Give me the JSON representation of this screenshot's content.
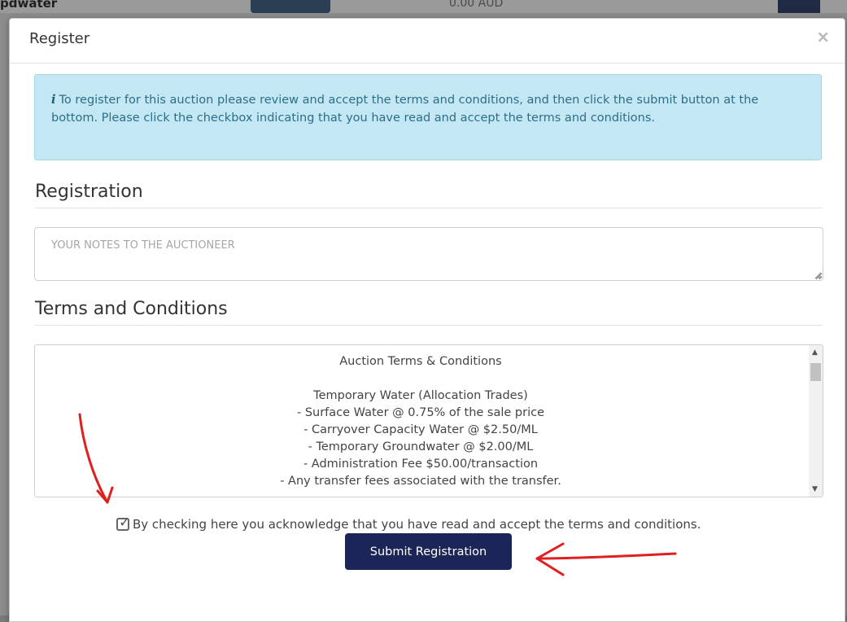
{
  "background": {
    "partial_text": "pdwater",
    "amount": "0.00 AUD"
  },
  "modal": {
    "title": "Register",
    "close_glyph": "×",
    "alert": {
      "icon": "info-icon",
      "text": "To register for this auction please review and accept the terms and conditions, and then click the submit button at the bottom. Please click the checkbox indicating that you have read and accept the terms and conditions."
    },
    "registration": {
      "title": "Registration",
      "notes_placeholder": "YOUR NOTES TO THE AUCTIONEER",
      "notes_value": ""
    },
    "terms": {
      "title": "Terms and Conditions",
      "heading": "Auction Terms & Conditions",
      "subheading": "Temporary Water (Allocation Trades)",
      "lines": [
        "- Surface Water @ 0.75% of the sale price",
        "- Carryover Capacity Water @ $2.50/ML",
        "- Temporary Groundwater @ $2.00/ML",
        "- Administration Fee $50.00/transaction",
        "- Any transfer fees associated with the transfer."
      ]
    },
    "acknowledge": {
      "checked": true,
      "label": "By checking here you acknowledge that you have read and accept the terms and conditions."
    },
    "submit_label": "Submit Registration"
  },
  "annotation_color": "#e02020"
}
